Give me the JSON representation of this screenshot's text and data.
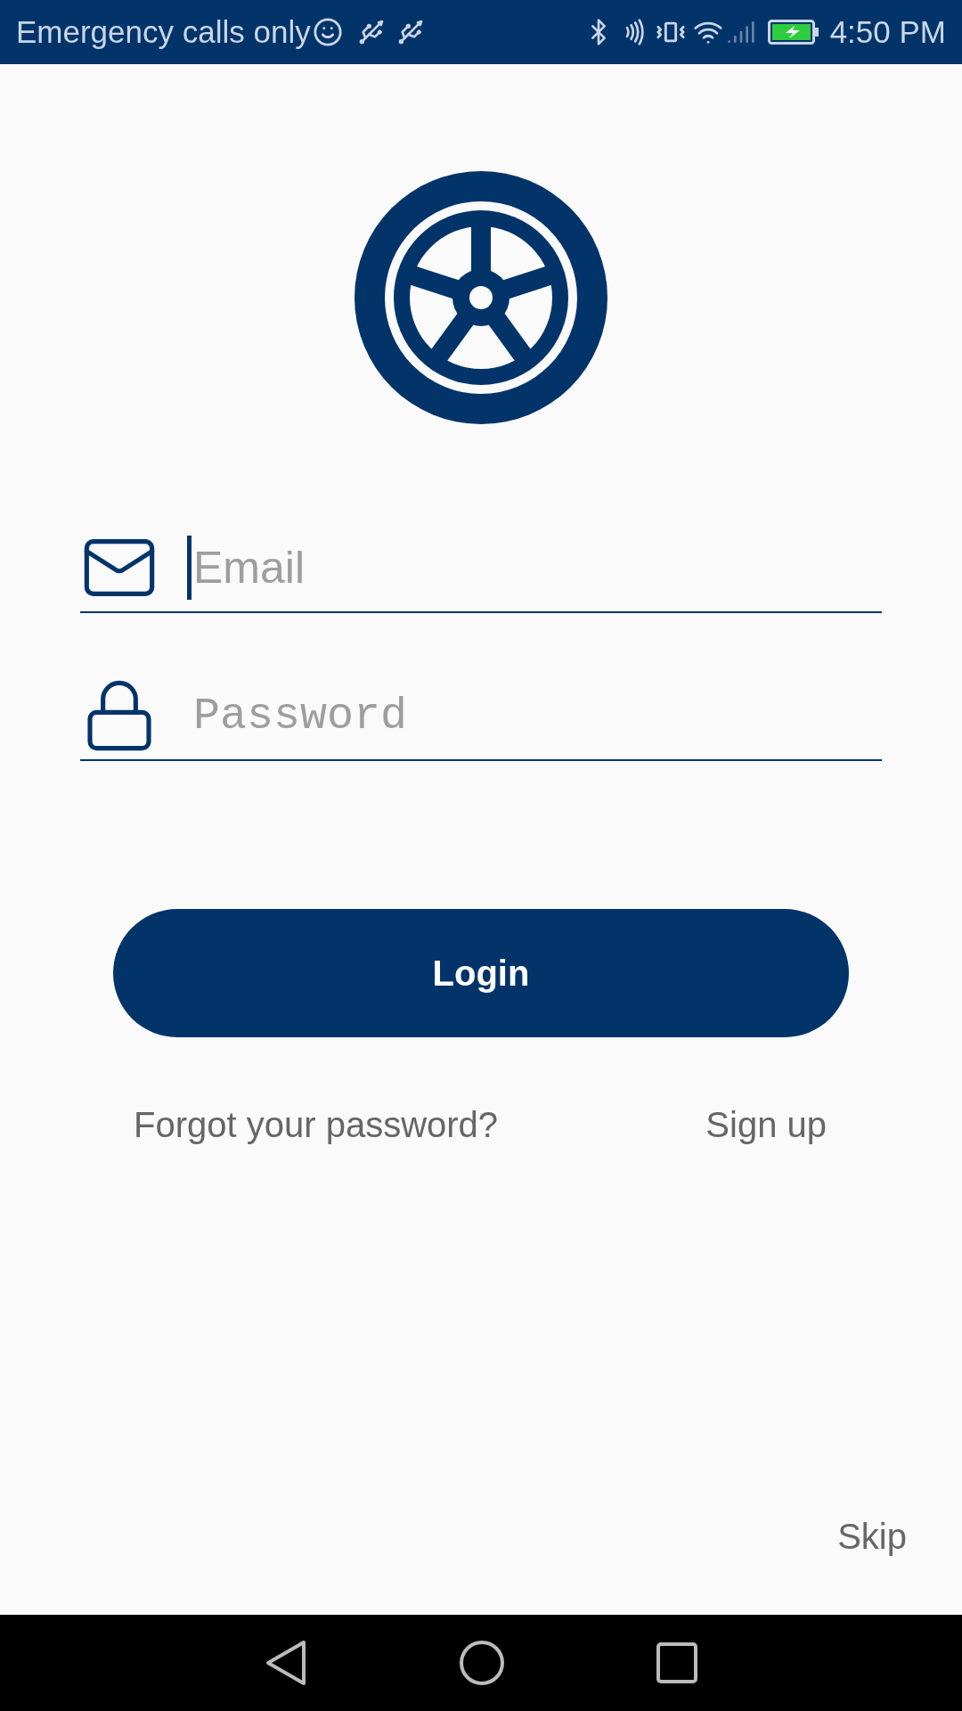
{
  "status_bar": {
    "carrier": "Emergency calls only",
    "time": "4:50 PM"
  },
  "form": {
    "fields": [
      {
        "kind": "email",
        "placeholder": "Email",
        "focused": true
      },
      {
        "kind": "password",
        "placeholder": "Password",
        "focused": false
      }
    ],
    "login_button": "Login",
    "links": [
      "Forgot your password?",
      "Sign up"
    ],
    "skip": "Skip"
  }
}
